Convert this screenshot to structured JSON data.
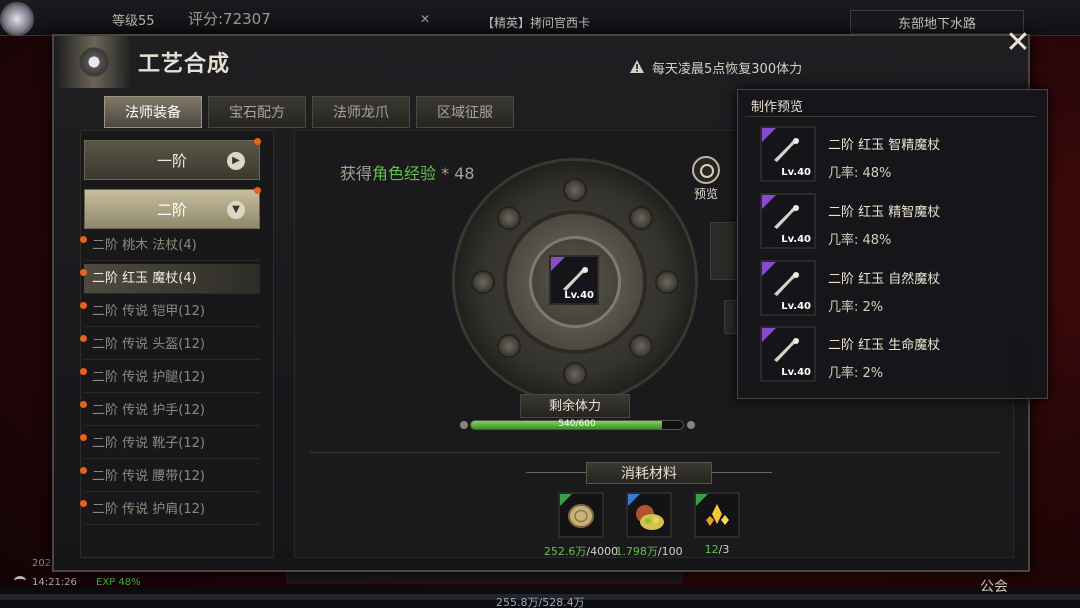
{
  "hud": {
    "level": "等级55",
    "score": "评分:72307",
    "quest_close": "✕",
    "quest": "【精英】拷问官西卡",
    "location": "东部地下水路",
    "time": "14:21:26",
    "date": "202",
    "exp": "EXP 48%",
    "weight": "255.8万/528.4万",
    "guild": "公会"
  },
  "panel": {
    "title": "工艺合成",
    "notice": "每天凌晨5点恢复300体力",
    "close_label": "✕"
  },
  "tabs": [
    {
      "label": "法师装备",
      "active": true
    },
    {
      "label": "宝石配方",
      "active": false
    },
    {
      "label": "法师龙爪",
      "active": false
    },
    {
      "label": "区域征服",
      "active": false
    }
  ],
  "sidebar": {
    "tier1": {
      "label": "一阶",
      "arrow": "▶"
    },
    "tier2": {
      "label": "二阶",
      "arrow": "▼"
    },
    "items": [
      {
        "label": "二阶 桃木 法杖(4)",
        "active": false
      },
      {
        "label": "二阶 红玉 魔杖(4)",
        "active": true
      },
      {
        "label": "二阶 传说 铠甲(12)",
        "active": false
      },
      {
        "label": "二阶 传说 头盔(12)",
        "active": false
      },
      {
        "label": "二阶 传说 护腿(12)",
        "active": false
      },
      {
        "label": "二阶 传说 护手(12)",
        "active": false
      },
      {
        "label": "二阶 传说 靴子(12)",
        "active": false
      },
      {
        "label": "二阶 传说 腰带(12)",
        "active": false
      },
      {
        "label": "二阶 传说 护肩(12)",
        "active": false
      }
    ]
  },
  "reward": {
    "prefix": "获得",
    "highlight": "角色经验",
    "suffix": " * 48"
  },
  "craft_item": {
    "level": "Lv.40",
    "icon": "wand-icon"
  },
  "preview_button": {
    "label": "预览"
  },
  "stamina": {
    "label": "剩余体力",
    "current": 540,
    "max": 600,
    "text": "540/600"
  },
  "materials": {
    "title": "消耗材料",
    "items": [
      {
        "icon": "coin-icon",
        "have": "252.6万",
        "need": "/4000",
        "corner": "#3aa14a"
      },
      {
        "icon": "ore-pile-icon",
        "have": "1.798万",
        "need": "/100",
        "corner": "#3a7bd6"
      },
      {
        "icon": "gold-crystal-icon",
        "have": "12",
        "need": "/3",
        "corner": "#3aa14a"
      }
    ]
  },
  "preview_popup": {
    "title": "制作预览",
    "items": [
      {
        "name": "二阶 红玉 智精魔杖",
        "rate": "几率: 48%",
        "level": "Lv.40"
      },
      {
        "name": "二阶 红玉 精智魔杖",
        "rate": "几率: 48%",
        "level": "Lv.40"
      },
      {
        "name": "二阶 红玉 自然魔杖",
        "rate": "几率: 2%",
        "level": "Lv.40"
      },
      {
        "name": "二阶 红玉 生命魔杖",
        "rate": "几率: 2%",
        "level": "Lv.40"
      }
    ]
  },
  "colors": {
    "accent_green": "#5fc24a",
    "rarity_purple": "#8a4ad0",
    "notify_orange": "#e8621c"
  }
}
